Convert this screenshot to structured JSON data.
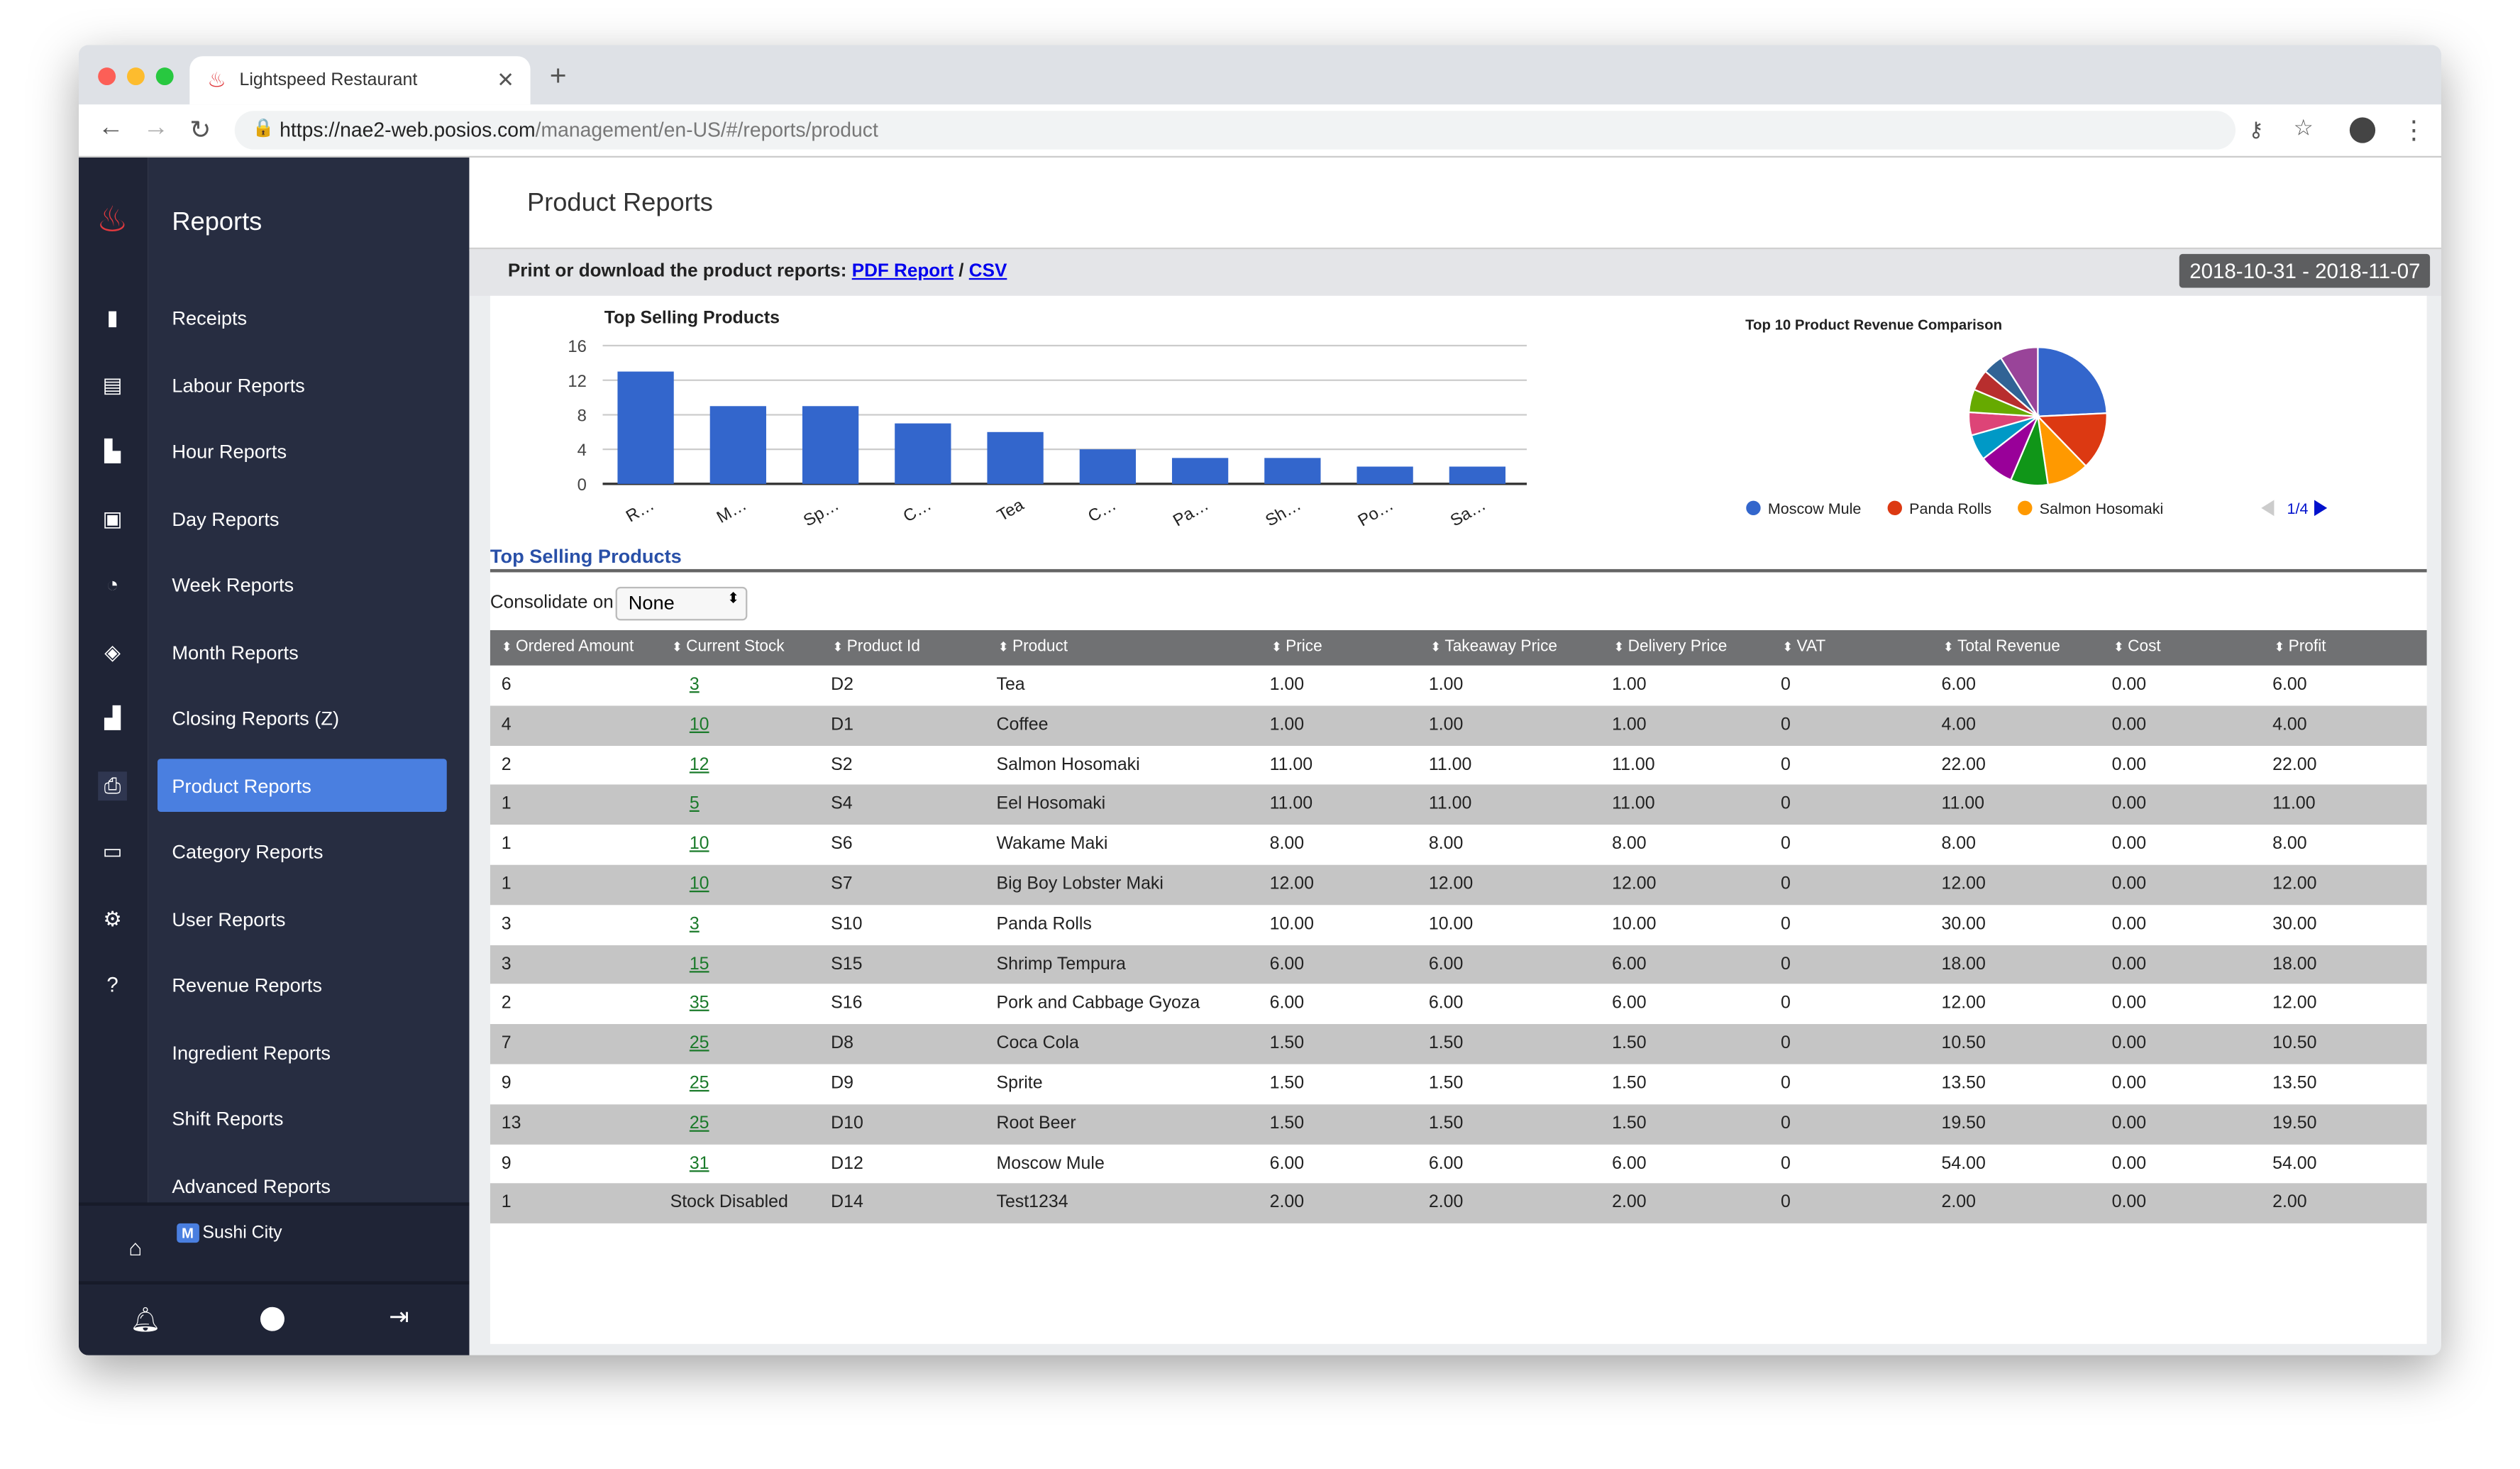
{
  "browser": {
    "tab_title": "Lightspeed Restaurant",
    "url_host": "https://nae2-web.posios.com",
    "url_path": "/management/en-US/#/reports/product"
  },
  "sidebar": {
    "title": "Reports",
    "items": [
      {
        "label": "Receipts",
        "icon": "bar-chart-icon"
      },
      {
        "label": "Labour Reports",
        "icon": "clipboard-icon"
      },
      {
        "label": "Hour Reports",
        "icon": "building-icon"
      },
      {
        "label": "Day Reports",
        "icon": "id-card-icon"
      },
      {
        "label": "Week Reports",
        "icon": "pie-icon"
      },
      {
        "label": "Month Reports",
        "icon": "layers-icon"
      },
      {
        "label": "Closing Reports (Z)",
        "icon": "register-icon"
      },
      {
        "label": "Product Reports",
        "icon": "printer-icon",
        "active": true
      },
      {
        "label": "Category Reports",
        "icon": "cards-icon"
      },
      {
        "label": "User Reports",
        "icon": "gear-icon"
      },
      {
        "label": "Revenue Reports",
        "icon": "help-icon"
      },
      {
        "label": "Ingredient Reports"
      },
      {
        "label": "Shift Reports"
      },
      {
        "label": "Advanced Reports"
      }
    ],
    "store_badge": "M",
    "store_name": "Sushi City"
  },
  "page": {
    "title": "Product Reports",
    "download_text": "Print or download the product reports:",
    "pdf_link": "PDF Report",
    "sep": "/",
    "csv_link": "CSV",
    "date_range": "2018-10-31 - 2018-11-07"
  },
  "chart_data": [
    {
      "type": "bar",
      "title": "Top Selling Products",
      "categories": [
        "R…",
        "M…",
        "Sp…",
        "C…",
        "Tea",
        "C…",
        "Pa…",
        "Sh…",
        "Po…",
        "Sa…"
      ],
      "values": [
        13,
        9,
        9,
        7,
        6,
        4,
        3,
        3,
        2,
        2
      ],
      "ylim": [
        0,
        16
      ],
      "yticks": [
        0,
        4,
        8,
        12,
        16
      ],
      "color": "#3366cc",
      "grid": true
    },
    {
      "type": "pie",
      "title": "Top 10 Product Revenue Comparison",
      "slices": [
        {
          "name": "Moscow Mule",
          "value": 54
        },
        {
          "name": "Panda Rolls",
          "value": 30
        },
        {
          "name": "Salmon Hosomaki",
          "value": 22
        },
        {
          "value": 19.5
        },
        {
          "value": 18
        },
        {
          "value": 13.5
        },
        {
          "value": 12
        },
        {
          "value": 12
        },
        {
          "value": 11
        },
        {
          "value": 10.5
        },
        {
          "value": 20
        }
      ],
      "colors": [
        "#3366cc",
        "#dc3912",
        "#ff9900",
        "#109618",
        "#990099",
        "#0099c6",
        "#dd4477",
        "#66aa00",
        "#b82e2e",
        "#316395",
        "#994499"
      ],
      "legend": [
        "Moscow Mule",
        "Panda Rolls",
        "Salmon Hosomaki"
      ],
      "legend_page": "1/4",
      "legend_placement": "bottom"
    }
  ],
  "table": {
    "section_title": "Top Selling Products",
    "consolidate_label": "Consolidate on",
    "consolidate_value": "None",
    "columns": [
      "Ordered Amount",
      "Current Stock",
      "Product Id",
      "Product",
      "Price",
      "Takeaway Price",
      "Delivery Price",
      "VAT",
      "Total Revenue",
      "Cost",
      "Profit"
    ],
    "rows": [
      [
        "6",
        "3",
        "D2",
        "Tea",
        "1.00",
        "1.00",
        "1.00",
        "0",
        "6.00",
        "0.00",
        "6.00"
      ],
      [
        "4",
        "10",
        "D1",
        "Coffee",
        "1.00",
        "1.00",
        "1.00",
        "0",
        "4.00",
        "0.00",
        "4.00"
      ],
      [
        "2",
        "12",
        "S2",
        "Salmon Hosomaki",
        "11.00",
        "11.00",
        "11.00",
        "0",
        "22.00",
        "0.00",
        "22.00"
      ],
      [
        "1",
        "5",
        "S4",
        "Eel Hosomaki",
        "11.00",
        "11.00",
        "11.00",
        "0",
        "11.00",
        "0.00",
        "11.00"
      ],
      [
        "1",
        "10",
        "S6",
        "Wakame Maki",
        "8.00",
        "8.00",
        "8.00",
        "0",
        "8.00",
        "0.00",
        "8.00"
      ],
      [
        "1",
        "10",
        "S7",
        "Big Boy Lobster Maki",
        "12.00",
        "12.00",
        "12.00",
        "0",
        "12.00",
        "0.00",
        "12.00"
      ],
      [
        "3",
        "3",
        "S10",
        "Panda Rolls",
        "10.00",
        "10.00",
        "10.00",
        "0",
        "30.00",
        "0.00",
        "30.00"
      ],
      [
        "3",
        "15",
        "S15",
        "Shrimp Tempura",
        "6.00",
        "6.00",
        "6.00",
        "0",
        "18.00",
        "0.00",
        "18.00"
      ],
      [
        "2",
        "35",
        "S16",
        "Pork and Cabbage Gyoza",
        "6.00",
        "6.00",
        "6.00",
        "0",
        "12.00",
        "0.00",
        "12.00"
      ],
      [
        "7",
        "25",
        "D8",
        "Coca Cola",
        "1.50",
        "1.50",
        "1.50",
        "0",
        "10.50",
        "0.00",
        "10.50"
      ],
      [
        "9",
        "25",
        "D9",
        "Sprite",
        "1.50",
        "1.50",
        "1.50",
        "0",
        "13.50",
        "0.00",
        "13.50"
      ],
      [
        "13",
        "25",
        "D10",
        "Root Beer",
        "1.50",
        "1.50",
        "1.50",
        "0",
        "19.50",
        "0.00",
        "19.50"
      ],
      [
        "9",
        "31",
        "D12",
        "Moscow Mule",
        "6.00",
        "6.00",
        "6.00",
        "0",
        "54.00",
        "0.00",
        "54.00"
      ],
      [
        "1",
        "Stock Disabled",
        "D14",
        "Test1234",
        "2.00",
        "2.00",
        "2.00",
        "0",
        "2.00",
        "0.00",
        "2.00"
      ]
    ]
  }
}
